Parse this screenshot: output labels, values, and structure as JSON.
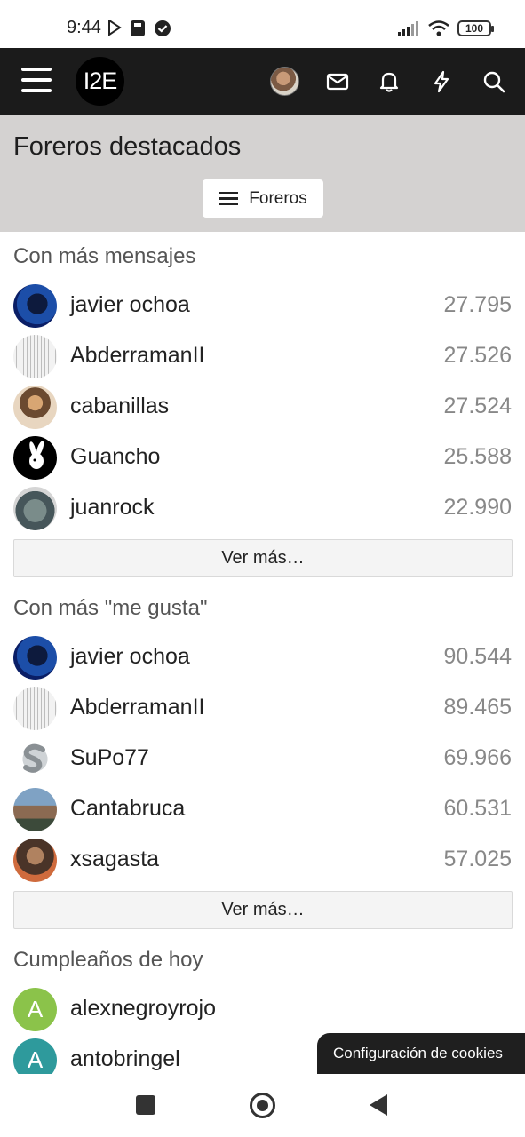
{
  "status_bar": {
    "time": "9:44",
    "battery": "100"
  },
  "header": {
    "logo_text": "I2E",
    "icons": [
      "menu-icon",
      "avatar",
      "mail-icon",
      "bell-icon",
      "lightning-icon",
      "search-icon"
    ],
    "bg_color": "#1b1b1b"
  },
  "page": {
    "title": "Foreros destacados",
    "filter_button": "Foreros"
  },
  "sections": {
    "messages": {
      "title": "Con más mensajes",
      "rows": [
        {
          "name": "javier ochoa",
          "value": "27.795"
        },
        {
          "name": "AbderramanII",
          "value": "27.526"
        },
        {
          "name": "cabanillas",
          "value": "27.524"
        },
        {
          "name": "Guancho",
          "value": "25.588"
        },
        {
          "name": "juanrock",
          "value": "22.990"
        }
      ],
      "more": "Ver más…"
    },
    "likes": {
      "title": "Con más \"me gusta\"",
      "rows": [
        {
          "name": "javier ochoa",
          "value": "90.544"
        },
        {
          "name": "AbderramanII",
          "value": "89.465"
        },
        {
          "name": "SuPo77",
          "value": "69.966"
        },
        {
          "name": "Cantabruca",
          "value": "60.531"
        },
        {
          "name": "xsagasta",
          "value": "57.025"
        }
      ],
      "more": "Ver más…"
    },
    "birthdays": {
      "title": "Cumpleaños de hoy",
      "rows": [
        {
          "name": "alexnegroyrojo",
          "initial": "A",
          "color": "#8bc34a"
        },
        {
          "name": "antobringel",
          "initial": "A",
          "color": "#2e9a9c"
        }
      ]
    }
  },
  "cookie_bar": {
    "label": "Configuración de cookies"
  }
}
